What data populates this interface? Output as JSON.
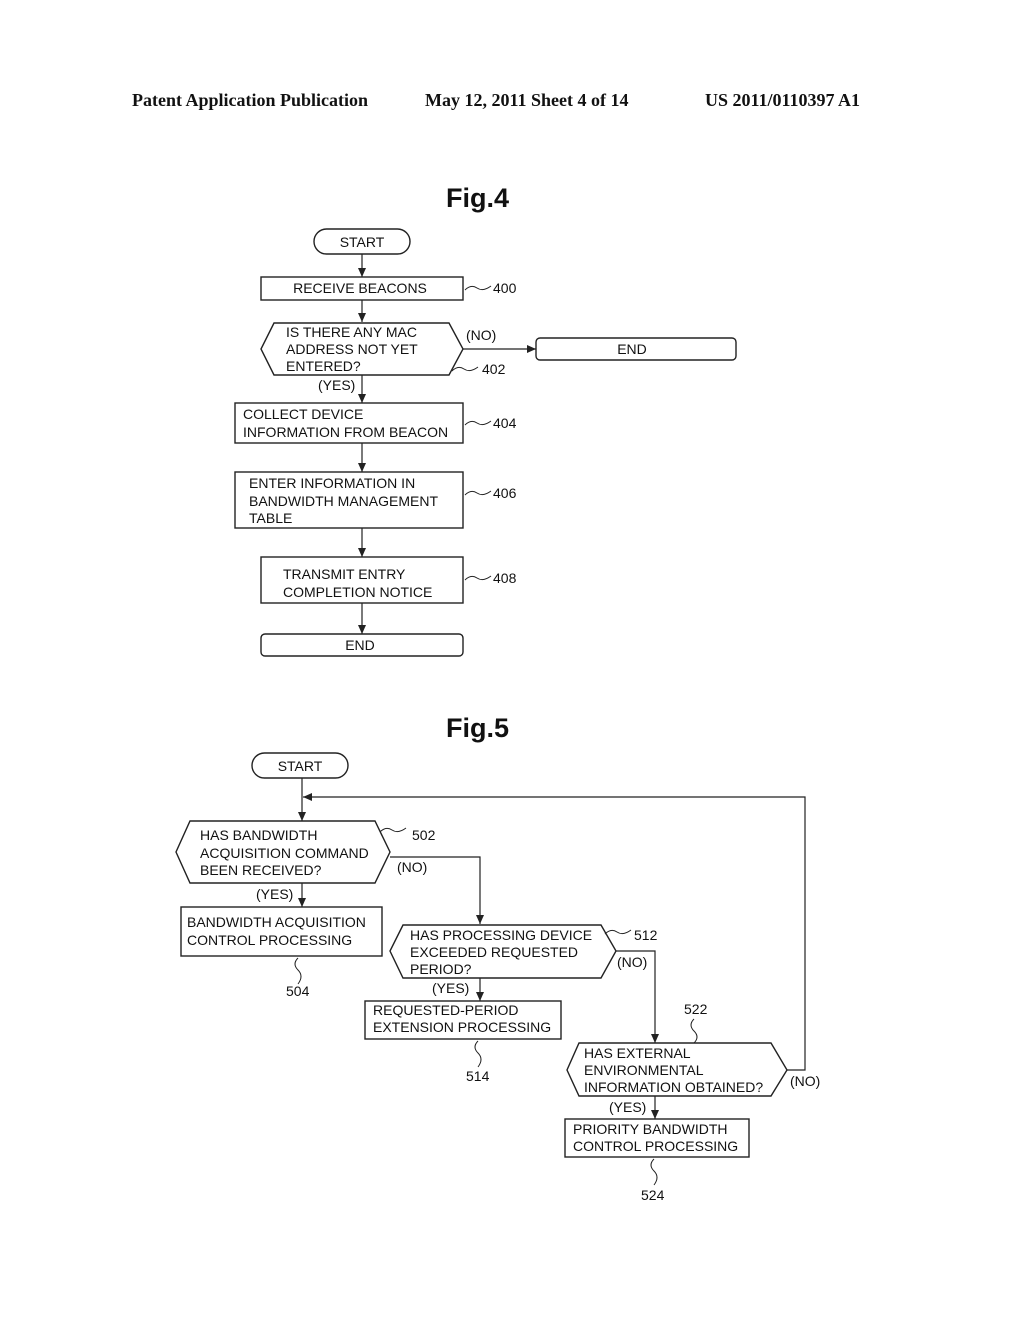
{
  "header": {
    "publication": "Patent Application Publication",
    "date_sheet": "May 12, 2011   Sheet 4 of 14",
    "number": "US 2011/0110397 A1"
  },
  "fig4": {
    "title": "Fig.4",
    "start": "START",
    "receive_beacons": {
      "text": "RECEIVE BEACONS",
      "ref": "400"
    },
    "mac_decision": {
      "lines": [
        "IS THERE ANY MAC",
        "ADDRESS NOT YET",
        "ENTERED?"
      ],
      "ref": "402",
      "no": "(NO)",
      "yes": "(YES)"
    },
    "end_no": "END",
    "collect_info": {
      "lines": [
        "COLLECT DEVICE",
        "INFORMATION FROM BEACON"
      ],
      "ref": "404"
    },
    "enter_info": {
      "lines": [
        "ENTER INFORMATION IN",
        "BANDWIDTH MANAGEMENT",
        "TABLE"
      ],
      "ref": "406"
    },
    "transmit_notice": {
      "lines": [
        "TRANSMIT ENTRY",
        "COMPLETION NOTICE"
      ],
      "ref": "408"
    },
    "end": "END"
  },
  "fig5": {
    "title": "Fig.5",
    "start": "START",
    "bw_cmd_decision": {
      "lines": [
        "HAS BANDWIDTH",
        "ACQUISITION COMMAND",
        "BEEN RECEIVED?"
      ],
      "ref": "502",
      "no": "(NO)",
      "yes": "(YES)"
    },
    "bw_acq_process": {
      "lines": [
        "BANDWIDTH ACQUISITION",
        "CONTROL PROCESSING"
      ],
      "ref": "504"
    },
    "period_decision": {
      "lines": [
        "HAS PROCESSING DEVICE",
        "EXCEEDED REQUESTED",
        "PERIOD?"
      ],
      "ref": "512",
      "no": "(NO)",
      "yes": "(YES)"
    },
    "period_ext_process": {
      "lines": [
        "REQUESTED-PERIOD",
        "EXTENSION PROCESSING"
      ],
      "ref": "514"
    },
    "env_decision": {
      "lines": [
        "HAS EXTERNAL",
        "ENVIRONMENTAL",
        "INFORMATION OBTAINED?"
      ],
      "ref": "522",
      "no": "(NO)",
      "yes": "(YES)"
    },
    "priority_process": {
      "lines": [
        "PRIORITY BANDWIDTH",
        "CONTROL PROCESSING"
      ],
      "ref": "524"
    }
  }
}
